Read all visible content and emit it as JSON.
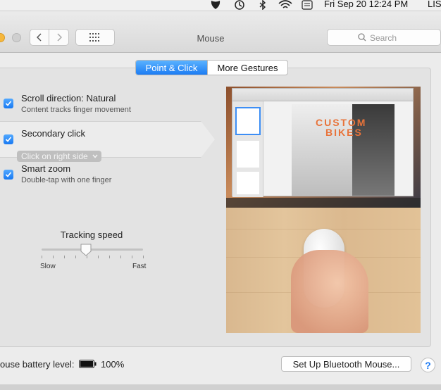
{
  "menubar": {
    "datetime": "Fri Sep 20  12:24 PM",
    "user_initials": "LIS",
    "icons": [
      "app-mask-icon",
      "time-machine-icon",
      "bluetooth-icon",
      "wifi-icon",
      "keyboard-input-icon"
    ]
  },
  "window": {
    "title": "Mouse",
    "search_placeholder": "Search"
  },
  "tabs": [
    {
      "label": "Point & Click",
      "active": true
    },
    {
      "label": "More Gestures",
      "active": false
    }
  ],
  "options": [
    {
      "title": "Scroll direction: Natural",
      "subtitle": "Content tracks finger movement",
      "checked": true
    },
    {
      "title": "Secondary click",
      "popup_value": "Click on right side",
      "checked": true
    },
    {
      "title": "Smart zoom",
      "subtitle": "Double-tap with one finger",
      "checked": true
    }
  ],
  "tracking": {
    "label": "Tracking speed",
    "min_label": "Slow",
    "max_label": "Fast",
    "value_fraction": 0.44
  },
  "preview": {
    "doc_heading_1": "CUSTOM",
    "doc_heading_2": "BIKES"
  },
  "footer": {
    "battery_label": "ouse battery level:",
    "battery_percent": "100%",
    "bluetooth_button": "Set Up Bluetooth Mouse..."
  },
  "colors": {
    "accent": "#1c7cf3",
    "orange": "#e8733a"
  }
}
